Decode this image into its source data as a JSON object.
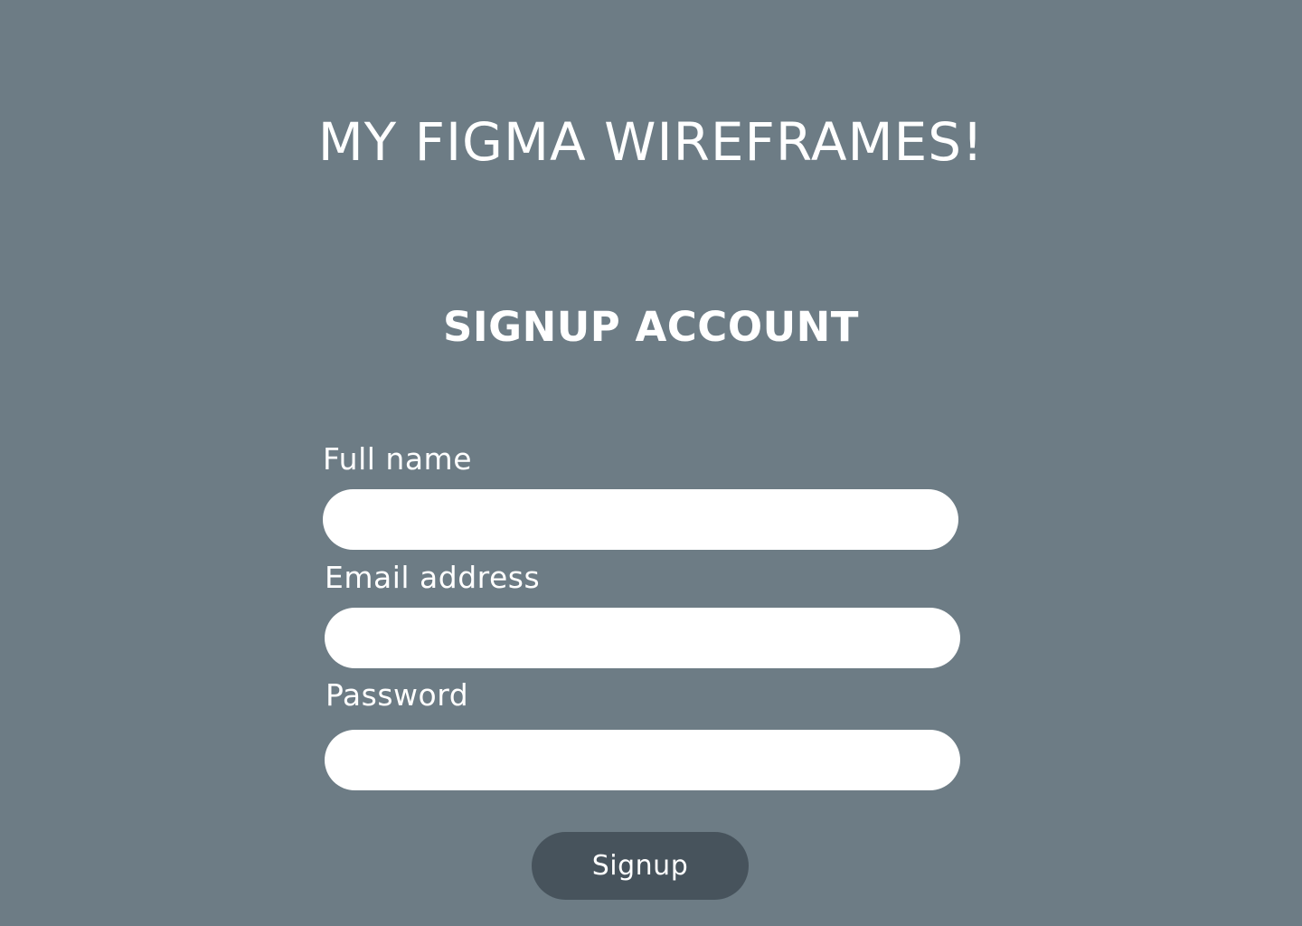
{
  "header": {
    "title": "MY FIGMA WIREFRAMES!"
  },
  "form": {
    "title": "SIGNUP ACCOUNT",
    "fields": [
      {
        "label": "Full name",
        "value": "",
        "placeholder": ""
      },
      {
        "label": "Email address",
        "value": "",
        "placeholder": ""
      },
      {
        "label": "Password",
        "value": "",
        "placeholder": ""
      }
    ],
    "submit_label": "Signup"
  },
  "colors": {
    "background": "#6d7c85",
    "input": "#ffffff",
    "button": "#47535c",
    "text": "#ffffff"
  }
}
